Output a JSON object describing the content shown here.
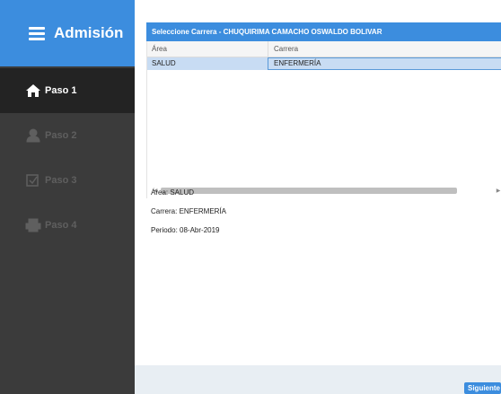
{
  "sidebar": {
    "title": "Admisión",
    "items": [
      {
        "label": "Paso 1",
        "icon": "home-icon",
        "state": "active"
      },
      {
        "label": "Paso 2",
        "icon": "user-icon",
        "state": "disabled"
      },
      {
        "label": "Paso 3",
        "icon": "checkbox-icon",
        "state": "disabled"
      },
      {
        "label": "Paso 4",
        "icon": "printer-icon",
        "state": "disabled"
      }
    ]
  },
  "panel": {
    "title": "Seleccione Carrera - CHUQUIRIMA CAMACHO OSWALDO BOLIVAR",
    "columns": [
      "Área",
      "Carrera"
    ],
    "rows": [
      {
        "area": "SALUD",
        "carrera": "ENFERMERÍA"
      }
    ]
  },
  "details": {
    "area": "Área: SALUD",
    "carrera": "Carrera: ENFERMERÍA",
    "periodo": "Periodo: 08-Abr-2019"
  },
  "footer": {
    "next_label": "Siguiente"
  },
  "colors": {
    "accent": "#3c8dde",
    "sidebar_bg": "#3b3b3b",
    "sidebar_active": "#232323",
    "row_selected": "#c8dcf3"
  }
}
